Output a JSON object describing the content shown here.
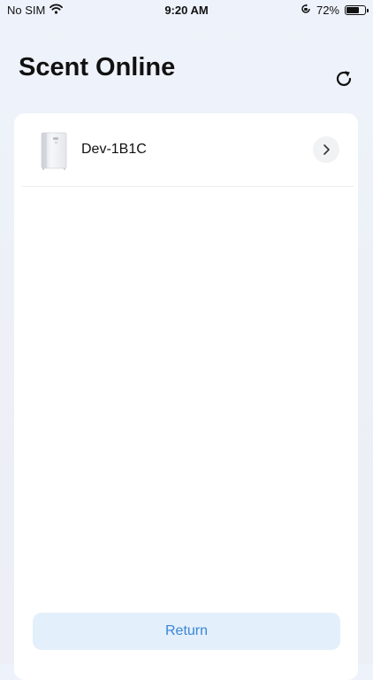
{
  "status_bar": {
    "carrier": "No SIM",
    "time": "9:20 AM",
    "battery_percent": "72%",
    "battery_level": 0.72,
    "icons": [
      "wifi-icon",
      "orientation-lock-icon",
      "battery-icon"
    ]
  },
  "header": {
    "title": "Scent Online",
    "refresh_icon": "refresh-icon"
  },
  "devices": [
    {
      "name": "Dev-1B1C",
      "thumbnail": "diffuser-device-icon",
      "action_icon": "chevron-right-icon"
    }
  ],
  "footer": {
    "return_label": "Return"
  },
  "colors": {
    "background": "#eef3fb",
    "card": "#ffffff",
    "accent": "#3a86d6",
    "button_bg": "#e3effb"
  }
}
